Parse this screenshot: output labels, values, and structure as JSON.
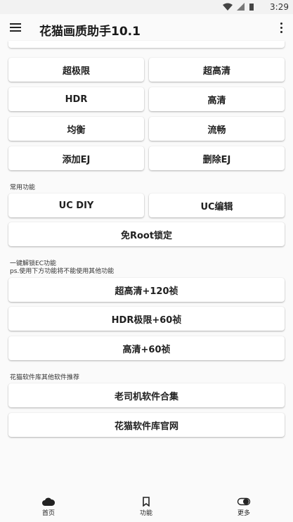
{
  "status_bar": {
    "time": "3:29"
  },
  "app_bar": {
    "title": "花猫画质助手10.1"
  },
  "quality_buttons": [
    {
      "label": "超极限"
    },
    {
      "label": "超高清"
    },
    {
      "label": "HDR"
    },
    {
      "label": "高清"
    },
    {
      "label": "均衡"
    },
    {
      "label": "流畅"
    },
    {
      "label": "添加EJ"
    },
    {
      "label": "删除EJ"
    }
  ],
  "common_section": {
    "heading": "常用功能",
    "uc_diy": "UC DIY",
    "uc_edit": "UC编辑",
    "root_lock": "免Root锁定"
  },
  "unlock_section": {
    "heading": "一键解锁EC功能",
    "note": "ps.使用下方功能将不能使用其他功能",
    "options": [
      {
        "label": "超高清+120祯"
      },
      {
        "label": "HDR极限+60祯"
      },
      {
        "label": "高清+60祯"
      }
    ]
  },
  "recommend_section": {
    "heading": "花猫软件库其他软件推荐",
    "options": [
      {
        "label": "老司机软件合集"
      },
      {
        "label": "花猫软件库官网"
      }
    ]
  },
  "bottom_nav": {
    "items": [
      {
        "label": "首页",
        "icon": "cloud-icon"
      },
      {
        "label": "功能",
        "icon": "bookmark-icon"
      },
      {
        "label": "更多",
        "icon": "toggle-icon"
      }
    ]
  }
}
